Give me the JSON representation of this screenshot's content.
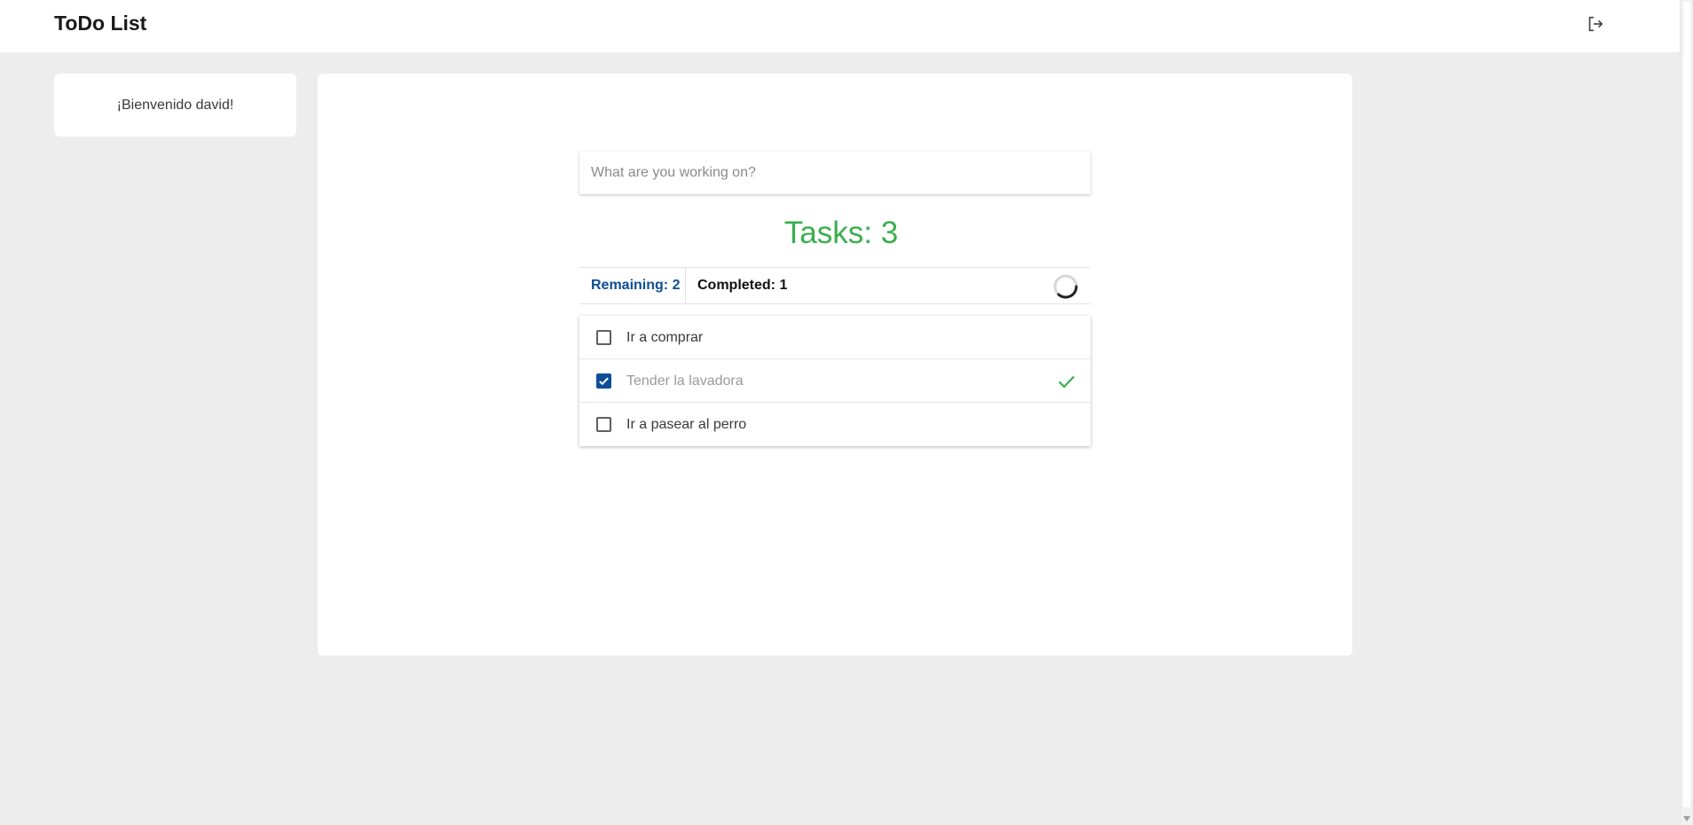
{
  "app": {
    "title": "ToDo List"
  },
  "header": {
    "logout_icon": "logout-icon"
  },
  "welcome": {
    "text": "¡Bienvenido david!"
  },
  "todo": {
    "input_placeholder": "What are you working on?",
    "title": "Tasks: 3",
    "filters": {
      "remaining": "Remaining: 2",
      "completed": "Completed: 1"
    },
    "tasks": [
      {
        "label": "Ir a comprar",
        "done": false
      },
      {
        "label": "Tender la lavadora",
        "done": true
      },
      {
        "label": "Ir a pasear al perro",
        "done": false
      }
    ]
  },
  "colors": {
    "accent_green": "#3cae4f",
    "accent_blue": "#0d4f96",
    "background": "#ededed"
  }
}
